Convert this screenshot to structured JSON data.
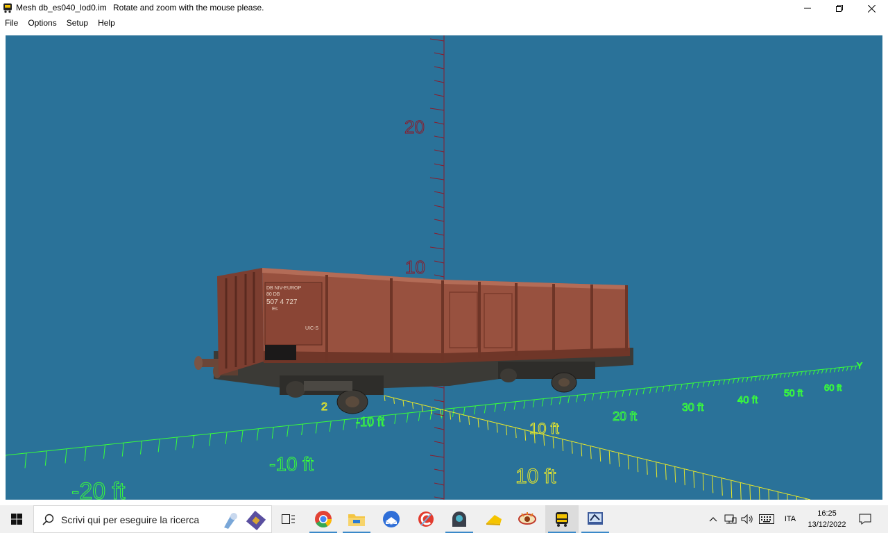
{
  "window": {
    "title": "Mesh db_es040_lod0.im",
    "hint": "Rotate and zoom with the mouse please.",
    "controls": [
      "minimize",
      "maximize",
      "close"
    ]
  },
  "menu": [
    "File",
    "Options",
    "Setup",
    "Help"
  ],
  "viewport": {
    "background": "#2a7299",
    "z_labels": [
      "20",
      "10"
    ],
    "y_labels": [
      "-20 ft",
      "-10 ft",
      "-10 ft",
      "20 ft",
      "30 ft",
      "40 ft",
      "50 ft",
      "60 ft"
    ],
    "y_axis_name": "Y",
    "x_labels": [
      "2",
      "10 ft",
      "10 ft"
    ],
    "colors": {
      "z_axis": "#8b1b2a",
      "y_axis": "#39ff39",
      "x_axis": "#e8e82a"
    },
    "object": "freight-wagon",
    "wagon_text": [
      "DB NIV-EUROP",
      "80 DB",
      "507 4 727",
      "Es",
      "UIC-S"
    ]
  },
  "taskbar": {
    "search_placeholder": "Scrivi qui per eseguire la ricerca",
    "apps": [
      "task-view-icon",
      "chrome-icon",
      "file-explorer-icon",
      "thunderbird-icon",
      "ccleaner-icon",
      "vpn-icon",
      "cheese-icon",
      "eye-app-icon",
      "bus-app-icon",
      "mesh-viewer-icon"
    ],
    "active_app": "bus-app-icon",
    "language": "ITA",
    "time": "16:25",
    "date": "13/12/2022"
  }
}
